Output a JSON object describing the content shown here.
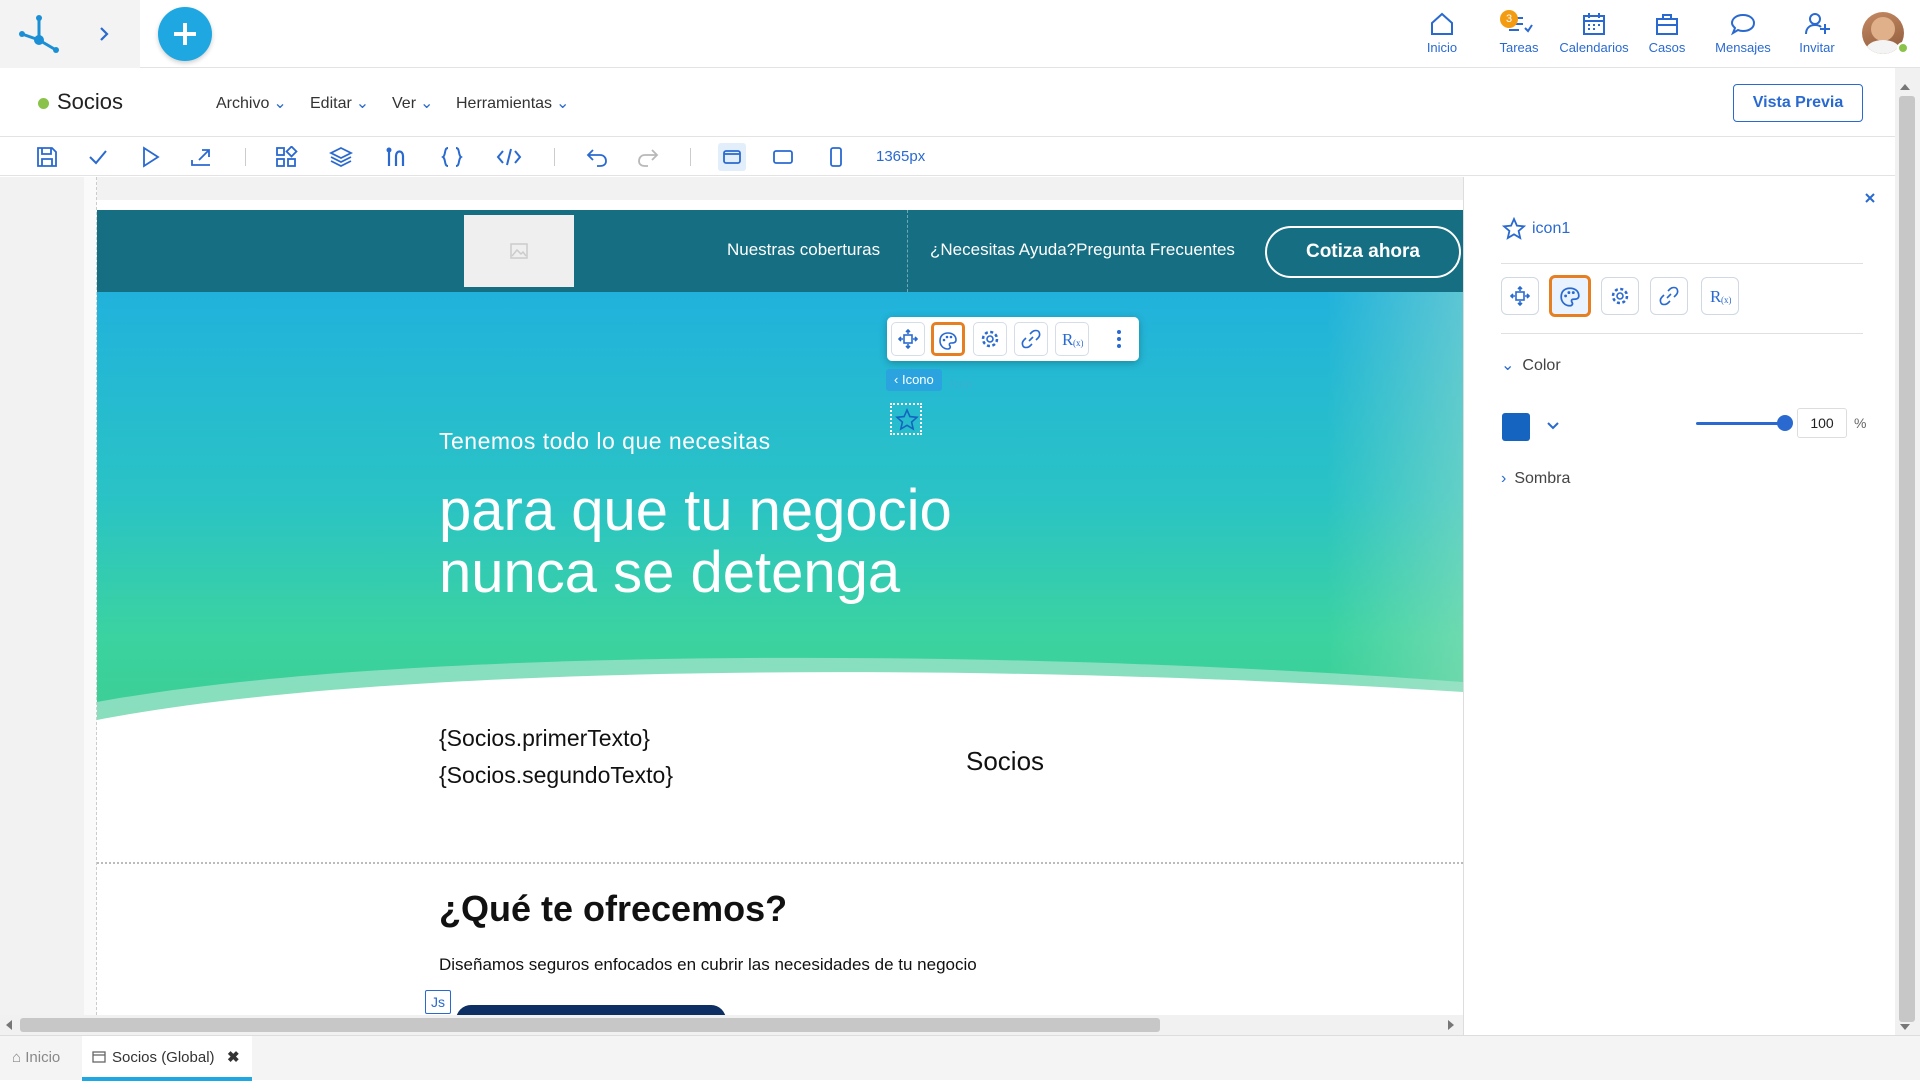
{
  "topnav": {
    "items": [
      {
        "label": "Inicio",
        "icon": "home-icon"
      },
      {
        "label": "Tareas",
        "icon": "tasks-icon",
        "badge": "3"
      },
      {
        "label": "Calendarios",
        "icon": "calendar-icon"
      },
      {
        "label": "Casos",
        "icon": "briefcase-icon"
      },
      {
        "label": "Mensajes",
        "icon": "chat-icon"
      },
      {
        "label": "Invitar",
        "icon": "invite-user-icon"
      }
    ]
  },
  "titlebar": {
    "title": "Socios",
    "status_color": "#8bc34a",
    "menus": [
      "Archivo",
      "Editar",
      "Ver",
      "Herramientas"
    ],
    "preview_button": "Vista Previa"
  },
  "toolbar": {
    "width_readout": "1365px"
  },
  "site": {
    "nav": [
      "Nuestras coberturas",
      "¿Necesitas Ayuda?Pregunta Frecuentes"
    ],
    "cta": "Cotiza ahora",
    "hero_subtitle": "Tenemos todo lo que necesitas",
    "hero_title_line1": "para que tu negocio",
    "hero_title_line2": "nunca se detenga",
    "var_text1": "{Socios.primerTexto}",
    "var_text2": "{Socios.segundoTexto}",
    "socios_label": "Socios",
    "section_title": "¿Qué te ofrecemos?",
    "section_text": "Diseñamos seguros enfocados en cubrir las necesidades de tu negocio",
    "js_tag": "Js"
  },
  "editor": {
    "selection_tag": "Icono",
    "ghost_label": "Icon"
  },
  "panel": {
    "element_name": "icon1",
    "color_section": "Color",
    "color_value": "#1565c0",
    "opacity": "100",
    "opacity_unit": "%",
    "opacity_level": 1.0,
    "shadow_section": "Sombra"
  },
  "bottomtabs": {
    "home": "Inicio",
    "active": "Socios (Global)"
  },
  "colors": {
    "accent": "#2a6ad0",
    "plus_button": "#1ea7e1",
    "header_bg": "#156e82",
    "active_border": "#e67e22"
  }
}
